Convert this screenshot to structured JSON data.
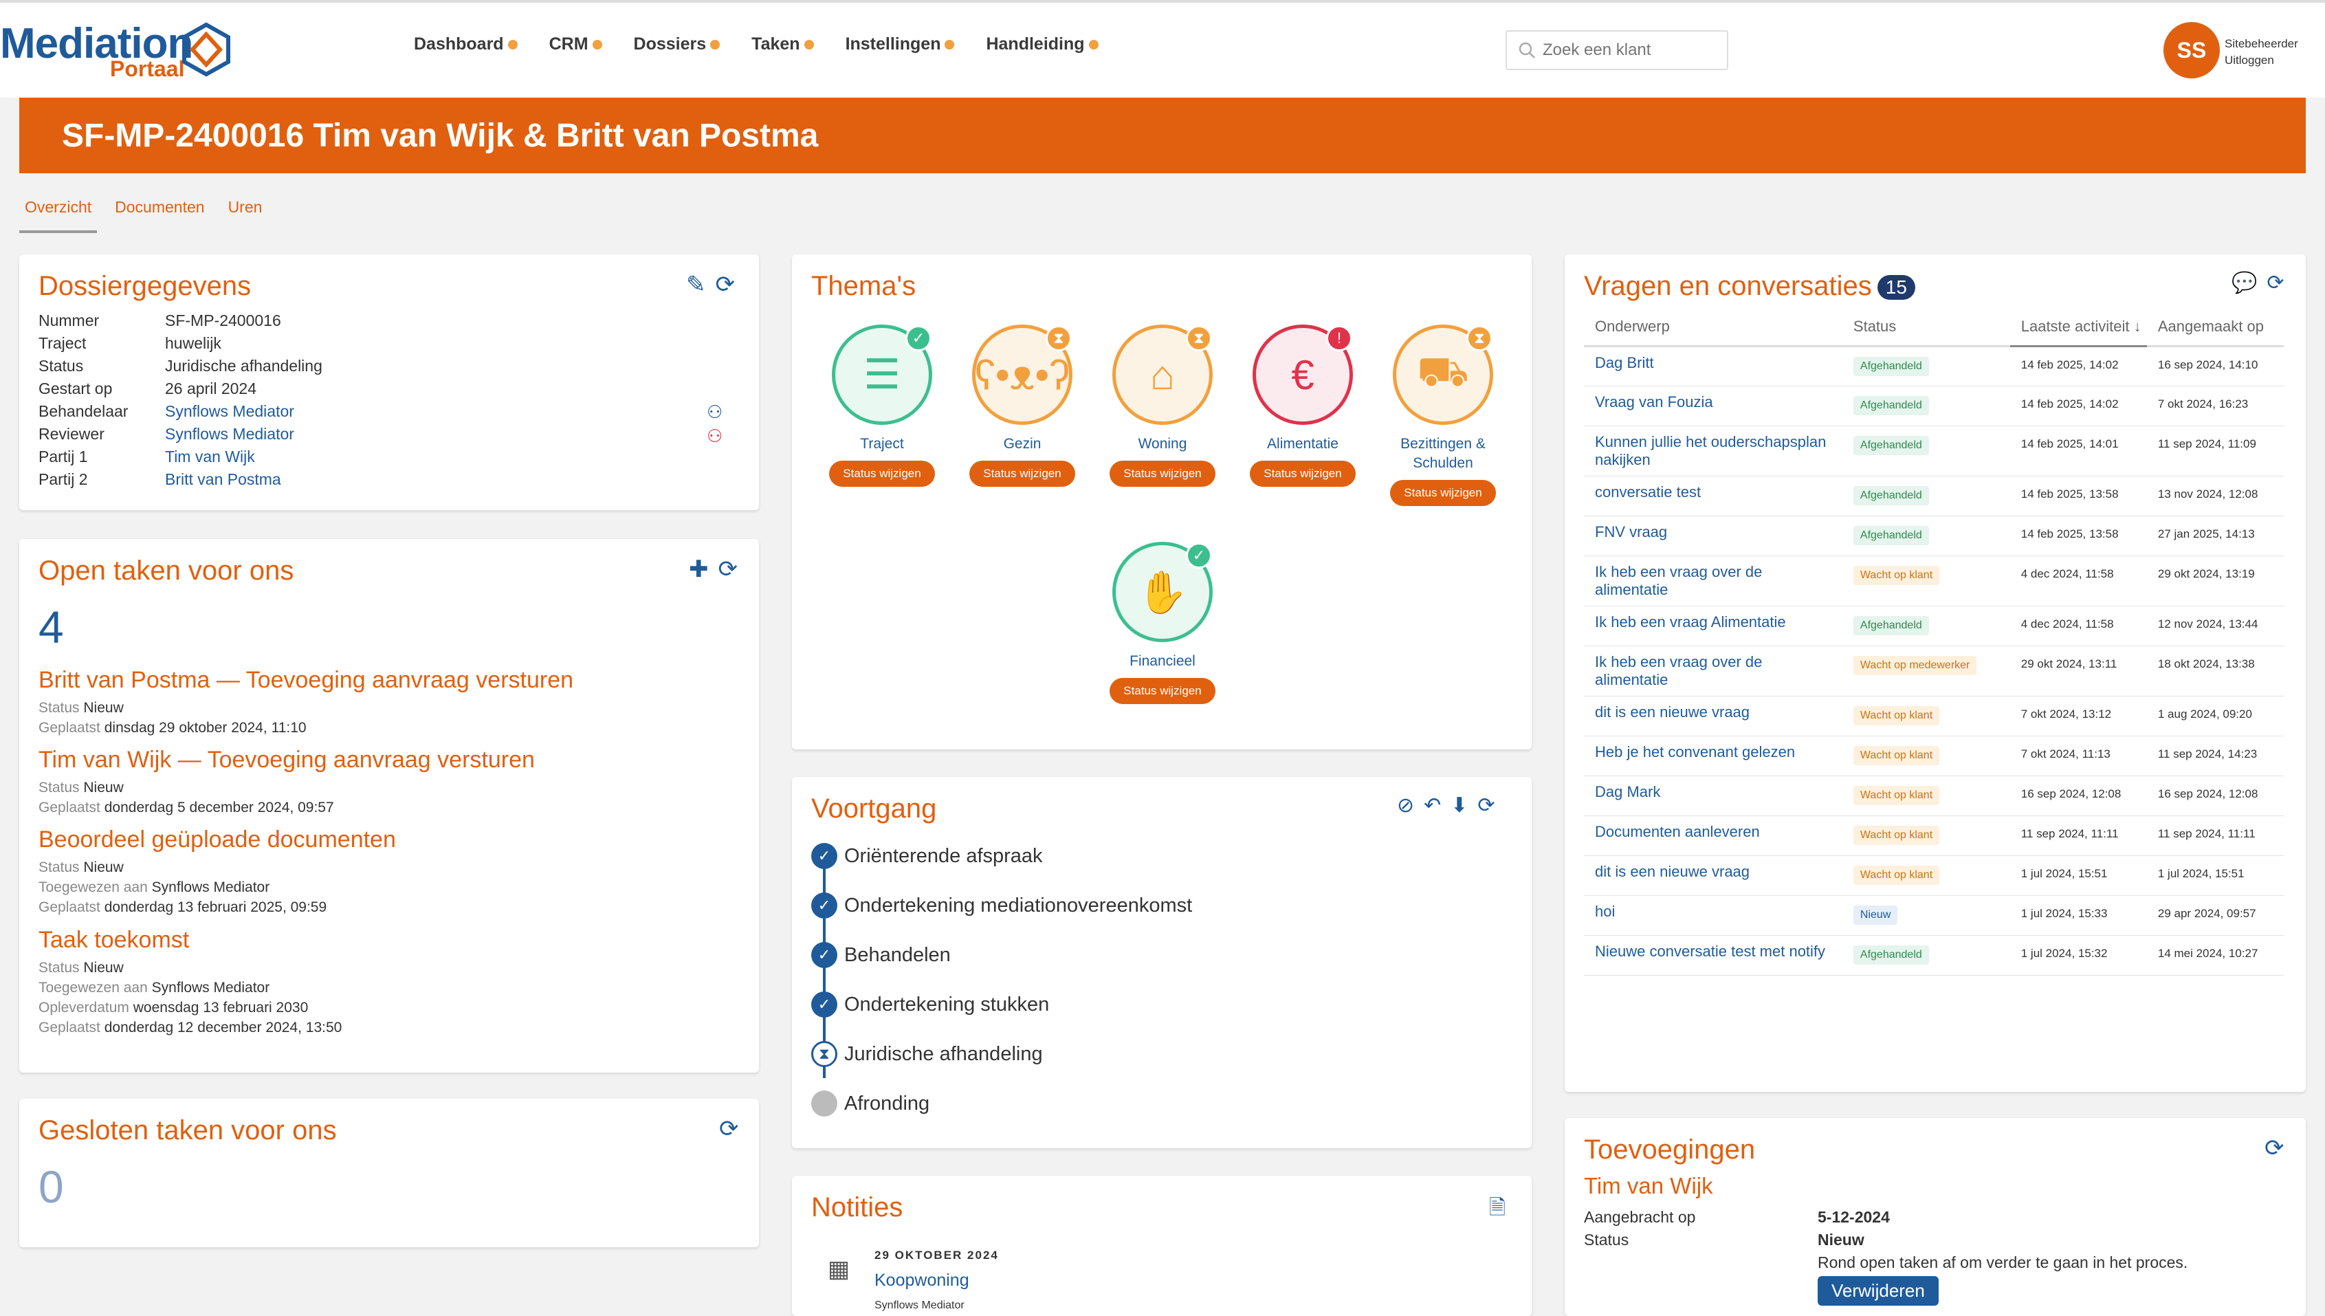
{
  "brand": {
    "name": "Mediation",
    "sub": "Portaal"
  },
  "nav": {
    "items": [
      {
        "label": "Dashboard"
      },
      {
        "label": "CRM"
      },
      {
        "label": "Dossiers"
      },
      {
        "label": "Taken"
      },
      {
        "label": "Instellingen"
      },
      {
        "label": "Handleiding"
      }
    ]
  },
  "search": {
    "placeholder": "Zoek een klant"
  },
  "user": {
    "initials": "SS",
    "name": "Sitebeheerder",
    "logout": "Uitloggen"
  },
  "banner": {
    "title": "SF-MP-2400016 Tim van Wijk & Britt van Postma"
  },
  "tabs": [
    {
      "label": "Overzicht"
    },
    {
      "label": "Documenten"
    },
    {
      "label": "Uren"
    }
  ],
  "dossier": {
    "title": "Dossiergegevens",
    "rows": [
      {
        "k": "Nummer",
        "v": "SF-MP-2400016"
      },
      {
        "k": "Traject",
        "v": "huwelijk"
      },
      {
        "k": "Status",
        "v": "Juridische afhandeling"
      },
      {
        "k": "Gestart op",
        "v": "26 april 2024"
      },
      {
        "k": "Behandelaar",
        "v": "Synflows Mediator"
      },
      {
        "k": "Reviewer",
        "v": "Synflows Mediator"
      },
      {
        "k": "Partij 1",
        "v": "Tim van Wijk"
      },
      {
        "k": "Partij 2",
        "v": "Britt van Postma"
      }
    ]
  },
  "open_tasks": {
    "title": "Open taken voor ons",
    "count": "4",
    "labels": {
      "status": "Status",
      "placed": "Geplaatst",
      "assigned": "Toegewezen aan",
      "due": "Opleverdatum"
    },
    "items": [
      {
        "title": "Britt van Postma — Toevoeging aanvraag versturen",
        "status": "Nieuw",
        "placed": "dinsdag 29 oktober 2024, 11:10"
      },
      {
        "title": "Tim van Wijk — Toevoeging aanvraag versturen",
        "status": "Nieuw",
        "placed": "donderdag 5 december 2024, 09:57"
      },
      {
        "title": "Beoordeel geüploade documenten",
        "status": "Nieuw",
        "assigned": "Synflows Mediator",
        "placed": "donderdag 13 februari 2025, 09:59"
      },
      {
        "title": "Taak toekomst",
        "status": "Nieuw",
        "assigned": "Synflows Mediator",
        "due": "woensdag 13 februari 2030",
        "placed": "donderdag 12 december 2024, 13:50"
      }
    ]
  },
  "closed_tasks": {
    "title": "Gesloten taken voor ons",
    "count": "0"
  },
  "themes": {
    "title": "Thema's",
    "button": "Status wijzigen",
    "items": [
      {
        "label": "Traject",
        "color": "#3cbf8f",
        "badge": "check",
        "icon": "list-icon"
      },
      {
        "label": "Gezin",
        "color": "#f2a03d",
        "badge": "hourglass",
        "icon": "teddy-bear-icon"
      },
      {
        "label": "Woning",
        "color": "#f2a03d",
        "badge": "hourglass",
        "icon": "house-icon"
      },
      {
        "label": "Alimentatie",
        "color": "#e0324b",
        "badge": "alert",
        "icon": "money-icon"
      },
      {
        "label": "Bezittingen & Schulden",
        "color": "#f2a03d",
        "badge": "hourglass",
        "icon": "car-icon"
      },
      {
        "label": "Financieel",
        "color": "#3cbf8f",
        "badge": "check",
        "icon": "hand-coin-icon"
      }
    ]
  },
  "progress": {
    "title": "Voortgang",
    "steps": [
      {
        "label": "Oriënterende afspraak",
        "state": "done"
      },
      {
        "label": "Ondertekening mediationovereenkomst",
        "state": "done"
      },
      {
        "label": "Behandelen",
        "state": "done"
      },
      {
        "label": "Ondertekening stukken",
        "state": "done"
      },
      {
        "label": "Juridische afhandeling",
        "state": "current"
      },
      {
        "label": "Afronding",
        "state": "todo"
      }
    ]
  },
  "notes": {
    "title": "Notities",
    "items": [
      {
        "date": "29 OKTOBER 2024",
        "title": "Koopwoning",
        "by": "Synflows Mediator"
      }
    ]
  },
  "conversations": {
    "title": "Vragen en conversaties",
    "count": "15",
    "columns": {
      "subject": "Onderwerp",
      "status": "Status",
      "last": "Laatste activiteit",
      "created": "Aangemaakt op"
    },
    "rows": [
      {
        "subject": "Dag Britt",
        "status": "Afgehandeld",
        "kind": "done",
        "last": "14 feb 2025, 14:02",
        "created": "16 sep 2024, 14:10"
      },
      {
        "subject": "Vraag van Fouzia",
        "status": "Afgehandeld",
        "kind": "done",
        "last": "14 feb 2025, 14:02",
        "created": "7 okt 2024, 16:23"
      },
      {
        "subject": "Kunnen jullie het ouderschapsplan nakijken",
        "status": "Afgehandeld",
        "kind": "done",
        "last": "14 feb 2025, 14:01",
        "created": "11 sep 2024, 11:09"
      },
      {
        "subject": "conversatie test",
        "status": "Afgehandeld",
        "kind": "done",
        "last": "14 feb 2025, 13:58",
        "created": "13 nov 2024, 12:08"
      },
      {
        "subject": "FNV vraag",
        "status": "Afgehandeld",
        "kind": "done",
        "last": "14 feb 2025, 13:58",
        "created": "27 jan 2025, 14:13"
      },
      {
        "subject": "Ik heb een vraag over de alimentatie",
        "status": "Wacht op klant",
        "kind": "wait",
        "last": "4 dec 2024, 11:58",
        "created": "29 okt 2024, 13:19"
      },
      {
        "subject": "Ik heb een vraag Alimentatie",
        "status": "Afgehandeld",
        "kind": "done",
        "last": "4 dec 2024, 11:58",
        "created": "12 nov 2024, 13:44"
      },
      {
        "subject": "Ik heb een vraag over de alimentatie",
        "status": "Wacht op medewerker",
        "kind": "wait",
        "last": "29 okt 2024, 13:11",
        "created": "18 okt 2024, 13:38"
      },
      {
        "subject": "dit is een nieuwe vraag",
        "status": "Wacht op klant",
        "kind": "wait",
        "last": "7 okt 2024, 13:12",
        "created": "1 aug 2024, 09:20"
      },
      {
        "subject": "Heb je het convenant gelezen",
        "status": "Wacht op klant",
        "kind": "wait",
        "last": "7 okt 2024, 11:13",
        "created": "11 sep 2024, 14:23"
      },
      {
        "subject": "Dag Mark",
        "status": "Wacht op klant",
        "kind": "wait",
        "last": "16 sep 2024, 12:08",
        "created": "16 sep 2024, 12:08"
      },
      {
        "subject": "Documenten aanleveren",
        "status": "Wacht op klant",
        "kind": "wait",
        "last": "11 sep 2024, 11:11",
        "created": "11 sep 2024, 11:11"
      },
      {
        "subject": "dit is een nieuwe vraag",
        "status": "Wacht op klant",
        "kind": "wait",
        "last": "1 jul 2024, 15:51",
        "created": "1 jul 2024, 15:51"
      },
      {
        "subject": "hoi",
        "status": "Nieuw",
        "kind": "new",
        "last": "1 jul 2024, 15:33",
        "created": "29 apr 2024, 09:57"
      },
      {
        "subject": "Nieuwe conversatie test met notify",
        "status": "Afgehandeld",
        "kind": "done",
        "last": "1 jul 2024, 15:32",
        "created": "14 mei 2024, 10:27"
      }
    ]
  },
  "additions": {
    "title": "Toevoegingen",
    "person": "Tim van Wijk",
    "applied_label": "Aangebracht op",
    "applied": "5-12-2024",
    "status_label": "Status",
    "status": "Nieuw",
    "message": "Rond open taken af om verder te gaan in het proces.",
    "delete": "Verwijderen"
  }
}
